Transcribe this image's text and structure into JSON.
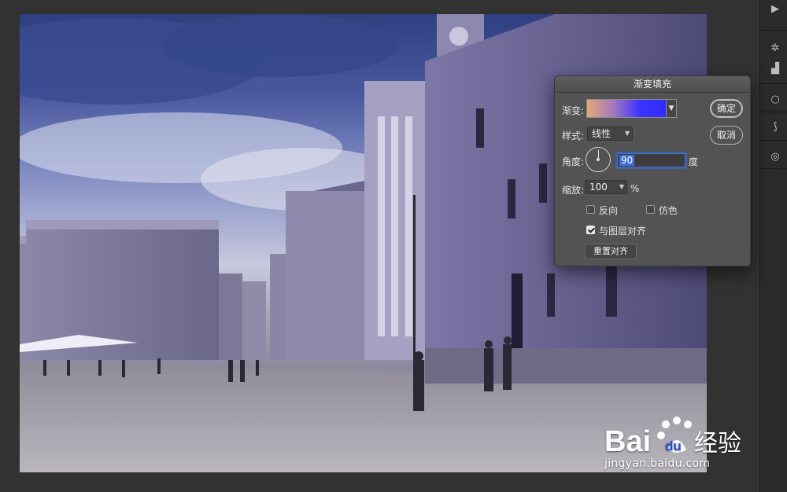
{
  "dialog": {
    "title": "渐变填充",
    "gradient_label": "渐变:",
    "style_label": "样式:",
    "style_value": "线性",
    "angle_label": "角度:",
    "angle_value": "90",
    "angle_unit": "度",
    "scale_label": "缩放:",
    "scale_value": "100",
    "scale_unit": "%",
    "reverse_label": "反向",
    "reverse_checked": false,
    "dither_label": "仿色",
    "dither_checked": false,
    "align_label": "与图层对齐",
    "align_checked": true,
    "reset_align_label": "重置对齐",
    "ok_label": "确定",
    "cancel_label": "取消",
    "gradient_colors": [
      "#e3a876",
      "#a37abe",
      "#3d33ff",
      "#2f2cff"
    ]
  },
  "right_strip": {
    "icons": [
      "play-icon",
      "adjustments-icon",
      "histogram-icon",
      "circle-icon",
      "brush-icon",
      "settings-icon"
    ]
  },
  "watermark": {
    "logo_text": "Bai 经验",
    "url": "jingyan.baidu.com"
  },
  "colors": {
    "app_background": "#323232",
    "dialog_background": "#535353",
    "accent": "#3d6fd6"
  }
}
